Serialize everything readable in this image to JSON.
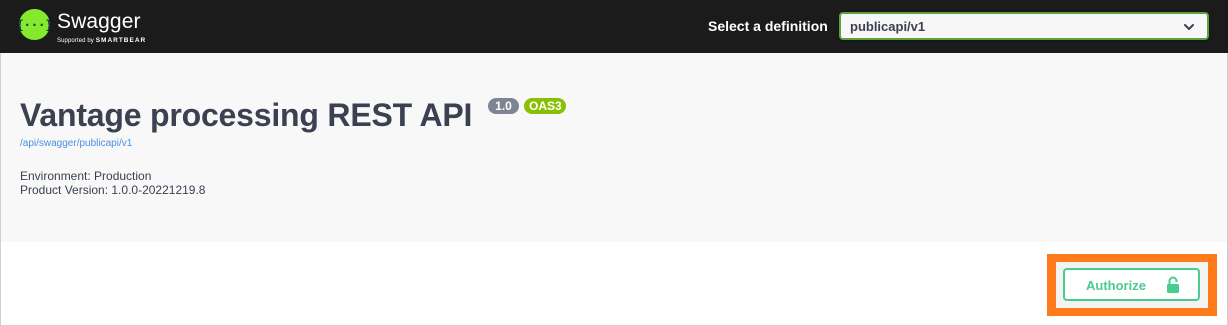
{
  "header": {
    "logo_name": "Swagger",
    "logo_tag_prefix": "Supported by",
    "logo_tag_brand": "SMARTBEAR",
    "definition_label": "Select a definition",
    "definition_value": "publicapi/v1",
    "accent_color": "#85ea2d"
  },
  "info": {
    "title": "Vantage processing REST API",
    "version_badge": "1.0",
    "oas_badge": "OAS3",
    "spec_link": "/api/swagger/publicapi/v1",
    "environment": "Environment: Production",
    "product_version": "Product Version: 1.0.0-20221219.8"
  },
  "actions": {
    "authorize_label": "Authorize",
    "authorize_icon": "unlock-icon",
    "authorize_color": "#49cc90",
    "highlight_color": "#ff7a1a"
  }
}
